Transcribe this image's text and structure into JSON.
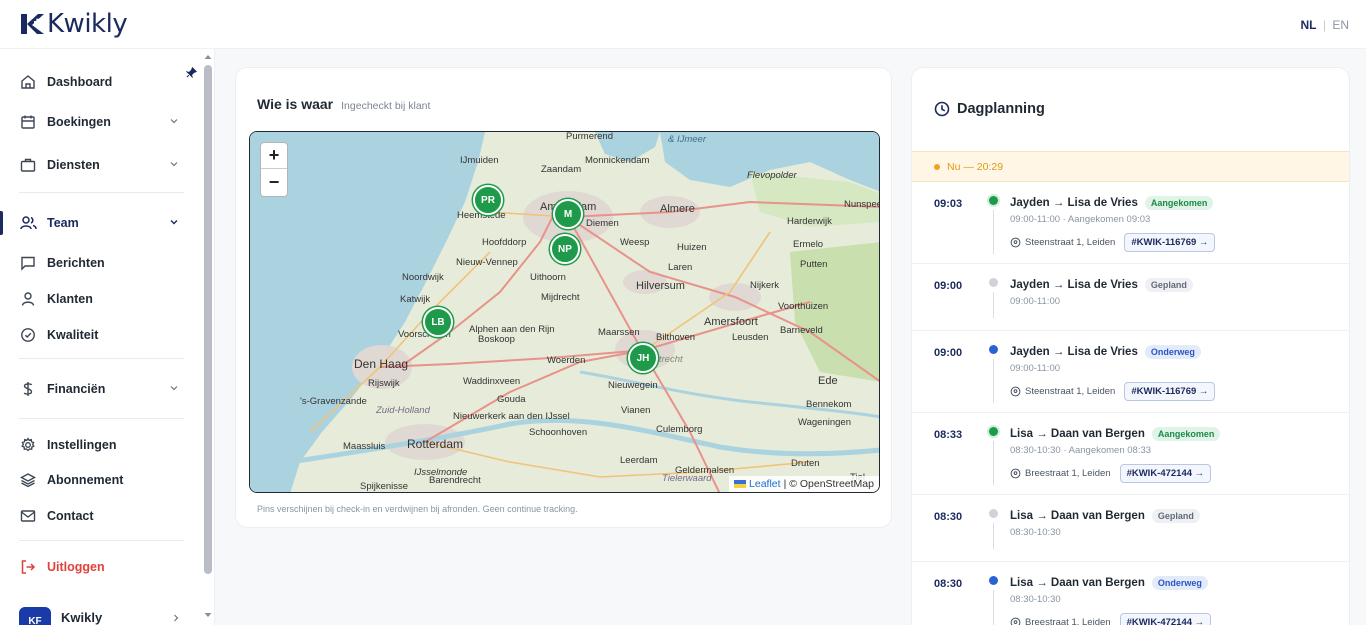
{
  "brand": {
    "name": "Kwikly"
  },
  "language": {
    "active": "NL",
    "separator": "|",
    "other": "EN"
  },
  "sidebar": {
    "items": [
      {
        "label": "Dashboard",
        "icon": "home-icon"
      },
      {
        "label": "Boekingen",
        "icon": "calendar-icon"
      },
      {
        "label": "Diensten",
        "icon": "briefcase-icon"
      },
      {
        "label": "Team",
        "icon": "users-icon"
      },
      {
        "label": "Berichten",
        "icon": "message-icon"
      },
      {
        "label": "Klanten",
        "icon": "user-icon"
      },
      {
        "label": "Kwaliteit",
        "icon": "check-circle-icon"
      },
      {
        "label": "Financiën",
        "icon": "dollar-icon"
      },
      {
        "label": "Instellingen",
        "icon": "gear-icon"
      },
      {
        "label": "Abonnement",
        "icon": "layers-icon"
      },
      {
        "label": "Contact",
        "icon": "mail-icon"
      },
      {
        "label": "Uitloggen",
        "icon": "logout-icon"
      }
    ],
    "account": {
      "initials": "KF",
      "name": "Kwikly"
    }
  },
  "map_card": {
    "title": "Wie is waar",
    "subtitle": "Ingecheckt bij klant",
    "zoom_in": "+",
    "zoom_out": "−",
    "attribution_link": "Leaflet",
    "attribution_text": "| © OpenStreetMap",
    "note": "Pins verschijnen bij check-in en verdwijnen bij afronden. Geen continue tracking.",
    "place_labels": [
      "Purmerend",
      "& IJmeer",
      "IJmuiden",
      "Zaandam",
      "Monnickendam",
      "Flevopolder",
      "Heemstede",
      "Amsterdam",
      "Diemen",
      "Almere",
      "Harderwijk",
      "Nunspeet",
      "Hoofddorp",
      "Weesp",
      "Huizen",
      "Ermelo",
      "Nieuw-Vennep",
      "Uithoorn",
      "Laren",
      "Putten",
      "Noordwijk",
      "Hilversum",
      "Nijkerk",
      "Katwijk",
      "Mijdrecht",
      "Voorthuizen",
      "Alphen aan den Rijn",
      "Voorschoten",
      "Amersfoort",
      "Barneveld",
      "Maarssen",
      "Bilthoven",
      "Leusden",
      "Den Haag",
      "Boskoop",
      "Woerden",
      "Utrecht",
      "Rijswijk",
      "Waddinxveen",
      "Nieuwegein",
      "Ede",
      "'s-Gravenzande",
      "Gouda",
      "Bennekom",
      "Zuid-Holland",
      "Nieuwerkerk aan den IJssel",
      "Vianen",
      "Wageningen",
      "Maassluis",
      "Rotterdam",
      "Schoonhoven",
      "Culemborg",
      "Leerdam",
      "Geldermalsen",
      "Druten",
      "Spijkenisse",
      "IJsselmonde",
      "Barendrecht",
      "Tielerwaard",
      "Tiel"
    ],
    "pins": [
      {
        "label": "PR"
      },
      {
        "label": "M"
      },
      {
        "label": "NP"
      },
      {
        "label": "LB"
      },
      {
        "label": "JH"
      }
    ]
  },
  "planning": {
    "title": "Dagplanning",
    "now": "Nu — 20:29",
    "entries": [
      {
        "time": "09:03",
        "who": "Jayden → Lisa de Vries",
        "status": "Aangekomen",
        "status_type": "arrived",
        "sub": "09:00-11:00 · Aangekomen 09:03",
        "address": "Steenstraat 1, Leiden",
        "booking": "#KWIK-116769 →"
      },
      {
        "time": "09:00",
        "who": "Jayden → Lisa de Vries",
        "status": "Gepland",
        "status_type": "planned",
        "sub": "09:00-11:00",
        "address": "",
        "booking": ""
      },
      {
        "time": "09:00",
        "who": "Jayden → Lisa de Vries",
        "status": "Onderweg",
        "status_type": "enroute",
        "sub": "09:00-11:00",
        "address": "Steenstraat 1, Leiden",
        "booking": "#KWIK-116769 →"
      },
      {
        "time": "08:33",
        "who": "Lisa → Daan van Bergen",
        "status": "Aangekomen",
        "status_type": "arrived",
        "sub": "08:30-10:30 · Aangekomen 08:33",
        "address": "Breestraat 1, Leiden",
        "booking": "#KWIK-472144 →"
      },
      {
        "time": "08:30",
        "who": "Lisa → Daan van Bergen",
        "status": "Gepland",
        "status_type": "planned",
        "sub": "08:30-10:30",
        "address": "",
        "booking": ""
      },
      {
        "time": "08:30",
        "who": "Lisa → Daan van Bergen",
        "status": "Onderweg",
        "status_type": "enroute",
        "sub": "08:30-10:30",
        "address": "Breestraat 1, Leiden",
        "booking": "#KWIK-472144 →"
      }
    ]
  },
  "colors": {
    "brand": "#1a2a5e",
    "pin": "#1e9a4a",
    "logout": "#e0413a",
    "now": "#f0a21e"
  }
}
